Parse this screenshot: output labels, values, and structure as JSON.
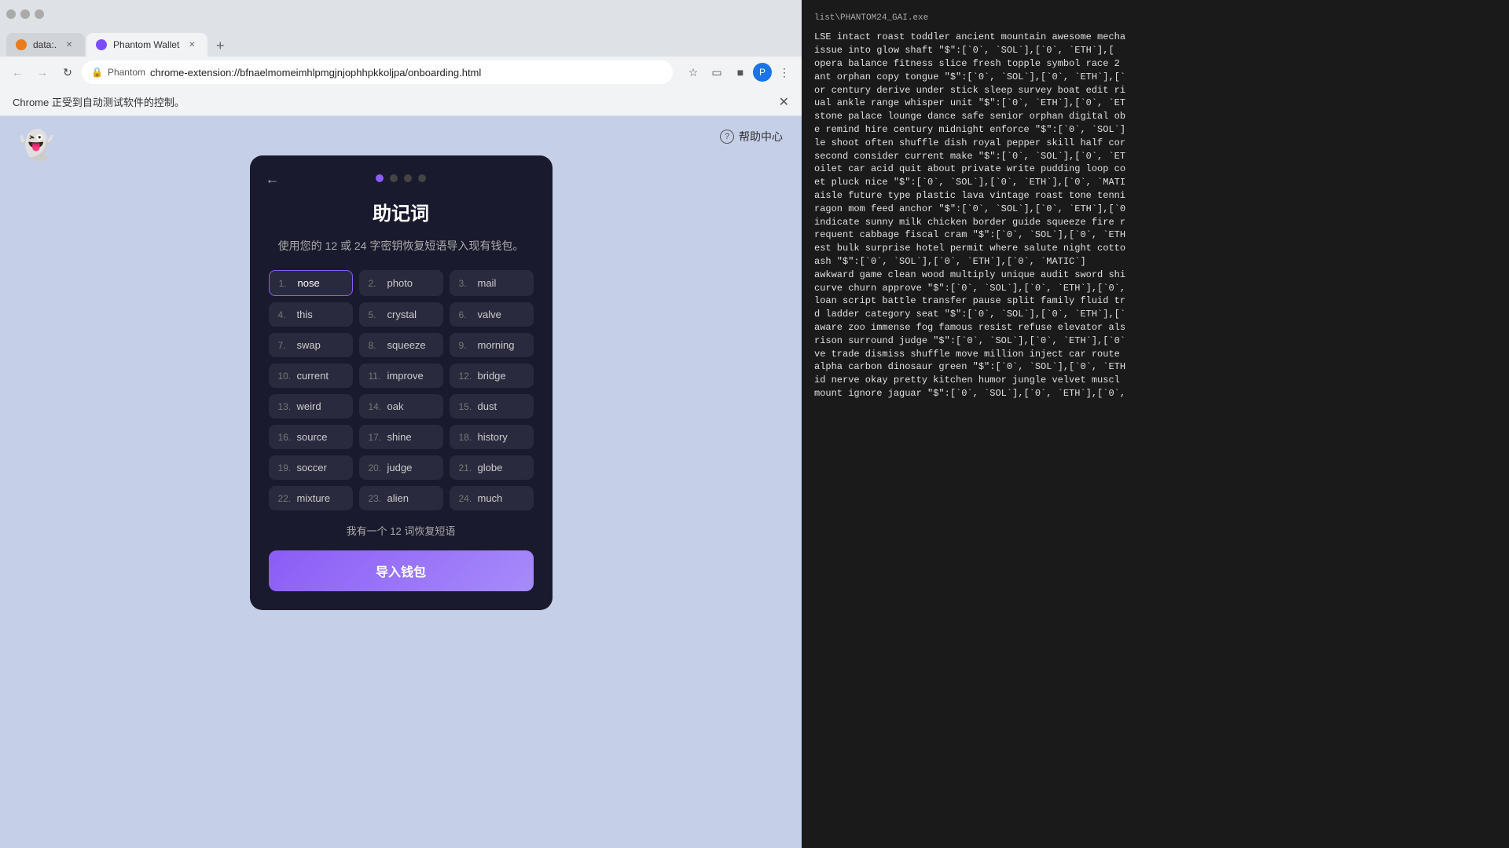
{
  "browser": {
    "tabs": [
      {
        "id": "tab1",
        "label": "data:.",
        "active": false
      },
      {
        "id": "tab2",
        "label": "Phantom Wallet",
        "active": true
      }
    ],
    "address": "chrome-extension://bfnaelmomeimhlpmgjnjophhpkkoljpa/onboarding.html",
    "notification": "Chrome 正受到自动测试软件的控制。"
  },
  "page": {
    "logo_emoji": "👻",
    "help_icon": "?",
    "help_label": "帮助中心"
  },
  "wallet_card": {
    "title": "助记词",
    "subtitle": "使用您的 12 或 24 字密钥恢复短语导入现有钱包。",
    "step_active": 0,
    "steps": [
      {
        "active": true
      },
      {
        "active": false
      },
      {
        "active": false
      },
      {
        "active": false
      }
    ],
    "seed_words": [
      {
        "num": "1.",
        "word": "nose",
        "editable": true
      },
      {
        "num": "2.",
        "word": "photo"
      },
      {
        "num": "3.",
        "word": "mail"
      },
      {
        "num": "4.",
        "word": "this"
      },
      {
        "num": "5.",
        "word": "crystal"
      },
      {
        "num": "6.",
        "word": "valve"
      },
      {
        "num": "7.",
        "word": "swap"
      },
      {
        "num": "8.",
        "word": "squeeze"
      },
      {
        "num": "9.",
        "word": "morning"
      },
      {
        "num": "10.",
        "word": "current"
      },
      {
        "num": "11.",
        "word": "improve"
      },
      {
        "num": "12.",
        "word": "bridge"
      },
      {
        "num": "13.",
        "word": "weird"
      },
      {
        "num": "14.",
        "word": "oak"
      },
      {
        "num": "15.",
        "word": "dust"
      },
      {
        "num": "16.",
        "word": "source"
      },
      {
        "num": "17.",
        "word": "shine"
      },
      {
        "num": "18.",
        "word": "history"
      },
      {
        "num": "19.",
        "word": "soccer"
      },
      {
        "num": "20.",
        "word": "judge"
      },
      {
        "num": "21.",
        "word": "globe"
      },
      {
        "num": "22.",
        "word": "mixture"
      },
      {
        "num": "23.",
        "word": "alien"
      },
      {
        "num": "24.",
        "word": "much"
      }
    ],
    "twelve_words_link": "我有一个 12 词恢复短语",
    "import_button": "导入钱包"
  },
  "terminal": {
    "title": "list\\PHANTOM24_GAI.exe",
    "content": "LSE intact roast toddler ancient mountain awesome mecha\nissue into glow shaft \"$\":[`0`, `SOL`],[`0`, `ETH`],[\nopera balance fitness slice fresh topple symbol race 2\nant orphan copy tongue \"$\":[`0`, `SOL`],[`0`, `ETH`],[`\nor century derive under stick sleep survey boat edit ri\nual ankle range whisper unit \"$\":[`0`, `ETH`],[`0`, `ET\nstone palace lounge dance safe senior orphan digital ob\ne remind hire century midnight enforce \"$\":[`0`, `SOL`]\nle shoot often shuffle dish royal pepper skill half cor\nsecond consider current make \"$\":[`0`, `SOL`],[`0`, `ET\noilet car acid quit about private write pudding loop co\net pluck nice \"$\":[`0`, `SOL`],[`0`, `ETH`],[`0`, `MATI\naisle future type plastic lava vintage roast tone tenni\nragon mom feed anchor \"$\":[`0`, `SOL`],[`0`, `ETH`],[`0\nindicate sunny milk chicken border guide squeeze fire r\nrequent cabbage fiscal cram \"$\":[`0`, `SOL`],[`0`, `ETH\nest bulk surprise hotel permit where salute night cotto\nash \"$\":[`0`, `SOL`],[`0`, `ETH`],[`0`, `MATIC`]\nawkward game clean wood multiply unique audit sword shi\ncurve churn approve \"$\":[`0`, `SOL`],[`0`, `ETH`],[`0`,\nloan script battle transfer pause split family fluid tr\nd ladder category seat \"$\":[`0`, `SOL`],[`0`, `ETH`],[`\naware zoo immense fog famous resist refuse elevator als\nrison surround judge \"$\":[`0`, `SOL`],[`0`, `ETH`],[`0`\nve trade dismiss shuffle move million inject car route\nalpha carbon dinosaur green \"$\":[`0`, `SOL`],[`0`, `ETH\nid nerve okay pretty kitchen humor jungle velvet muscl\nmount ignore jaguar \"$\":[`0`, `SOL`],[`0`, `ETH`],[`0`,"
  }
}
